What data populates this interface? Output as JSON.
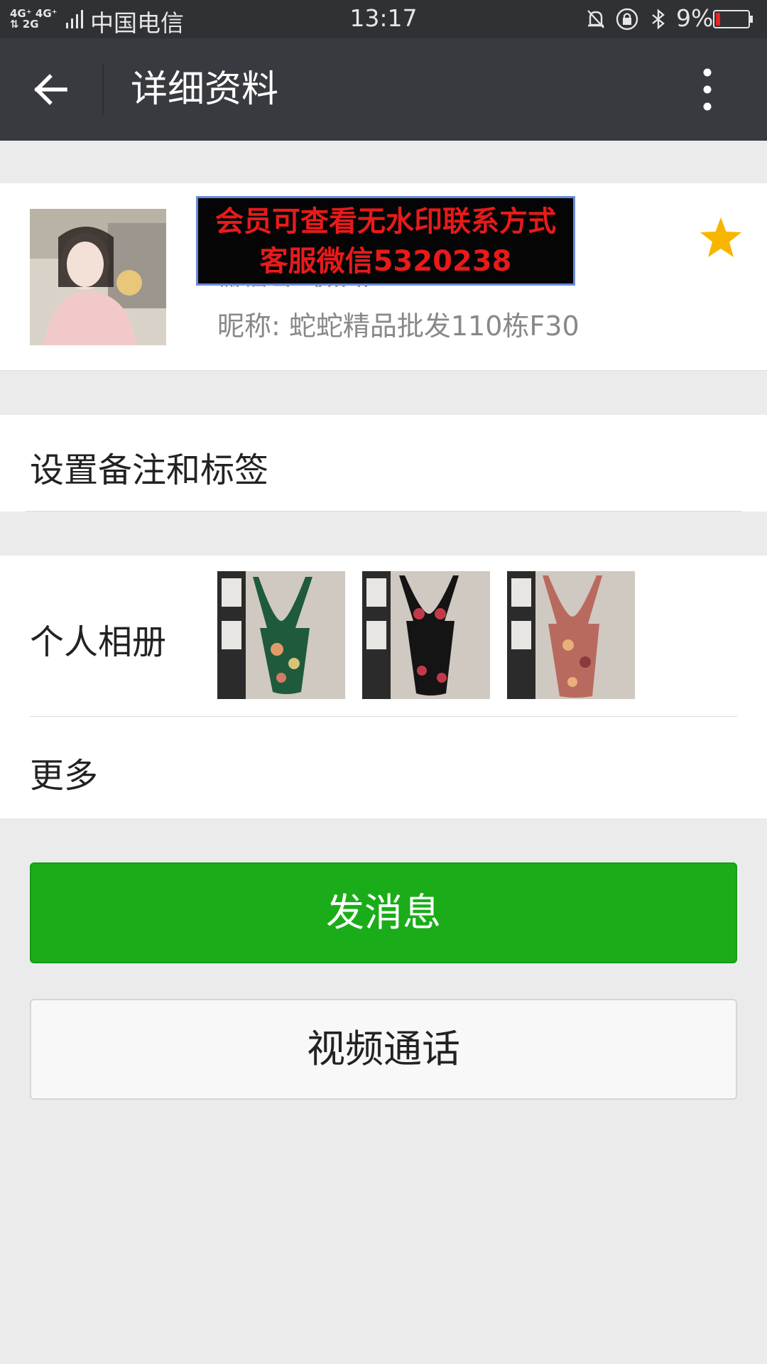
{
  "status_bar": {
    "network": "4G+ 4G+\n2G",
    "carrier": "中国电信",
    "time": "13:17",
    "battery": "9%",
    "icons": [
      "signal-icon",
      "mute-icon",
      "rotation-lock-icon",
      "bluetooth-icon",
      "battery-icon"
    ]
  },
  "top_bar": {
    "title": "详细资料",
    "back_icon": "back-arrow-icon",
    "more_icon": "more-vertical-icon"
  },
  "profile": {
    "watermark_line1": "会员可查看无水印联系方式",
    "watermark_line2": "客服微信5320238",
    "wechat_id": "微信号: yili li",
    "nickname": "昵称: 蛇蛇精品批发110栋F30",
    "star_icon": "star-icon",
    "colors": {
      "star": "#f7b500",
      "watermark_text": "#e81a1a"
    }
  },
  "remark": {
    "label": "设置备注和标签"
  },
  "album": {
    "label": "个人相册",
    "photos": [
      {
        "name": "album-photo-green-swimsuit",
        "color": "#1f5a3c"
      },
      {
        "name": "album-photo-black-swimsuit",
        "color": "#1a1a1a"
      },
      {
        "name": "album-photo-pink-swimsuit",
        "color": "#b96a5f"
      }
    ]
  },
  "more": {
    "label": "更多"
  },
  "actions": {
    "message_label": "发消息",
    "video_label": "视频通话",
    "colors": {
      "primary": "#1aad19"
    }
  }
}
